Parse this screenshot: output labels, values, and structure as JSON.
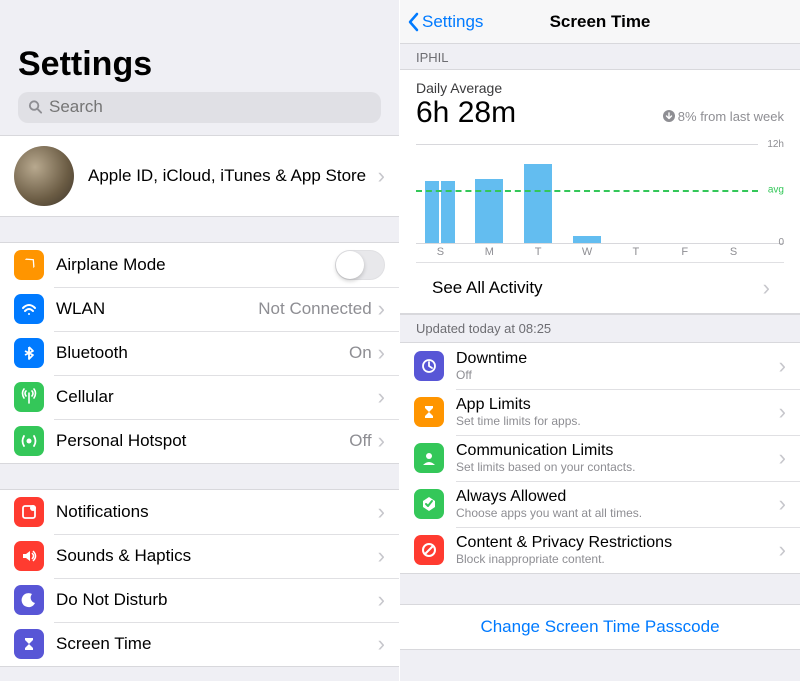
{
  "left": {
    "title": "Settings",
    "search_placeholder": "Search",
    "profile_sub": "Apple ID, iCloud, iTunes & App Store",
    "groups": [
      [
        {
          "icon": "airplane",
          "color": "#ff9500",
          "label": "Airplane Mode",
          "detail": "",
          "type": "switch"
        },
        {
          "icon": "wifi",
          "color": "#007aff",
          "label": "WLAN",
          "detail": "Not Connected",
          "type": "link"
        },
        {
          "icon": "bluetooth",
          "color": "#007aff",
          "label": "Bluetooth",
          "detail": "On",
          "type": "link"
        },
        {
          "icon": "antenna",
          "color": "#34c759",
          "label": "Cellular",
          "detail": "",
          "type": "link"
        },
        {
          "icon": "hotspot",
          "color": "#34c759",
          "label": "Personal Hotspot",
          "detail": "Off",
          "type": "link"
        }
      ],
      [
        {
          "icon": "notify",
          "color": "#ff3b30",
          "label": "Notifications",
          "detail": "",
          "type": "link"
        },
        {
          "icon": "sound",
          "color": "#ff3b30",
          "label": "Sounds & Haptics",
          "detail": "",
          "type": "link"
        },
        {
          "icon": "moon",
          "color": "#5856d6",
          "label": "Do Not Disturb",
          "detail": "",
          "type": "link"
        },
        {
          "icon": "hourglass",
          "color": "#5856d6",
          "label": "Screen Time",
          "detail": "",
          "type": "link"
        }
      ]
    ]
  },
  "right": {
    "back_label": "Settings",
    "nav_title": "Screen Time",
    "device_header": "IPHIL",
    "daily_average_label": "Daily Average",
    "daily_average_value": "6h 28m",
    "change_text": "8% from last week",
    "y_top": "12h",
    "y_bot": "0",
    "avg_label": "avg",
    "see_all": "See All Activity",
    "updated": "Updated today at 08:25",
    "rows": [
      {
        "icon": "clock",
        "color": "#5856d6",
        "title": "Downtime",
        "sub": "Off"
      },
      {
        "icon": "hourglass",
        "color": "#ff9500",
        "title": "App Limits",
        "sub": "Set time limits for apps."
      },
      {
        "icon": "people",
        "color": "#34c759",
        "title": "Communication Limits",
        "sub": "Set limits based on your contacts."
      },
      {
        "icon": "check",
        "color": "#34c759",
        "title": "Always Allowed",
        "sub": "Choose apps you want at all times."
      },
      {
        "icon": "nope",
        "color": "#ff3b30",
        "title": "Content & Privacy Restrictions",
        "sub": "Block inappropriate content."
      }
    ],
    "change_passcode": "Change Screen Time Passcode"
  },
  "chart_data": {
    "type": "bar",
    "categories": [
      "S",
      "M",
      "T",
      "W",
      "T",
      "F",
      "S"
    ],
    "values": [
      7.5,
      7.8,
      9.6,
      0.9,
      0,
      0,
      0
    ],
    "sunday_halves": [
      7.5,
      7.5
    ],
    "avg": 6.47,
    "ylim": [
      0,
      12
    ],
    "ylabel_top": "12h",
    "ylabel_bot": "0"
  }
}
